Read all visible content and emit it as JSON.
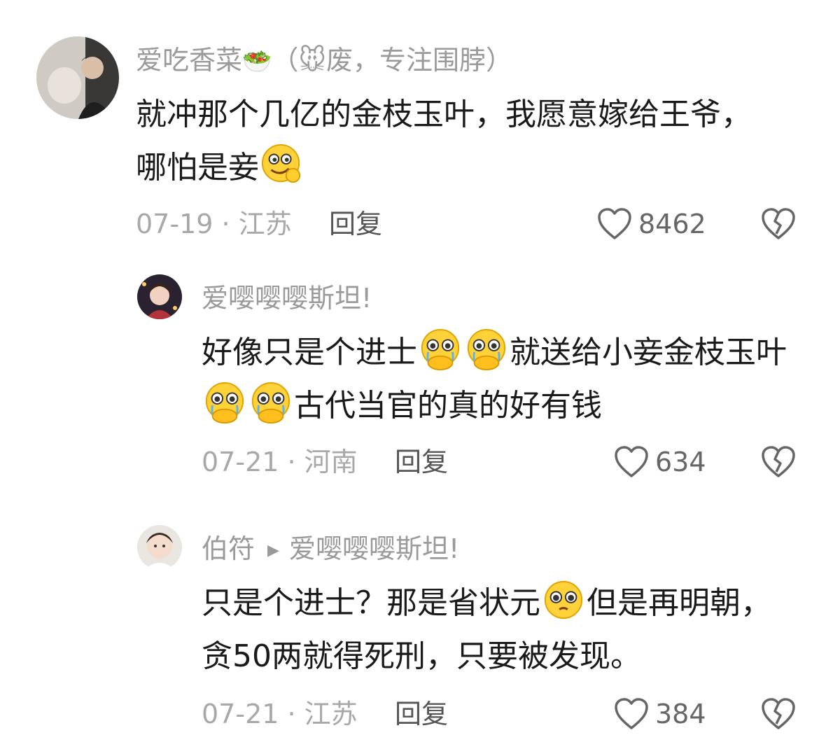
{
  "comments": [
    {
      "author": "爱吃香菜",
      "author_suffix": "（🐭废，专注围脖）",
      "text_parts": [
        "就冲那个几亿的金枝玉叶，我愿意嫁给王爷，哪怕是妾"
      ],
      "date_loc": "07-19 · 江苏",
      "reply_label": "回复",
      "likes": "8462"
    },
    {
      "author": "爱嘤嘤嘤斯坦!",
      "text_parts": [
        "好像只是个进士",
        "就送给小妾金枝玉叶",
        "古代当官的真的好有钱"
      ],
      "date_loc": "07-21 · 河南",
      "reply_label": "回复",
      "likes": "634"
    },
    {
      "author": "伯符",
      "reply_to": "爱嘤嘤嘤斯坦!",
      "text_parts": [
        "只是个进士？那是省状元",
        "但是再明朝，贪50两就得死刑，只要被发现。"
      ],
      "date_loc": "07-21 · 江苏",
      "reply_label": "回复",
      "likes": "384"
    }
  ],
  "icons": {
    "like": "heart-outline-icon",
    "dislike": "broken-heart-icon",
    "emoji_smile": "yummy-face-emoji",
    "emoji_pleading": "pleading-hands-face-emoji",
    "emoji_teary": "pleading-face-emoji"
  },
  "colors": {
    "name": "#9a9a9a",
    "meta": "#a8a8a8",
    "text": "#1a1a1a"
  }
}
